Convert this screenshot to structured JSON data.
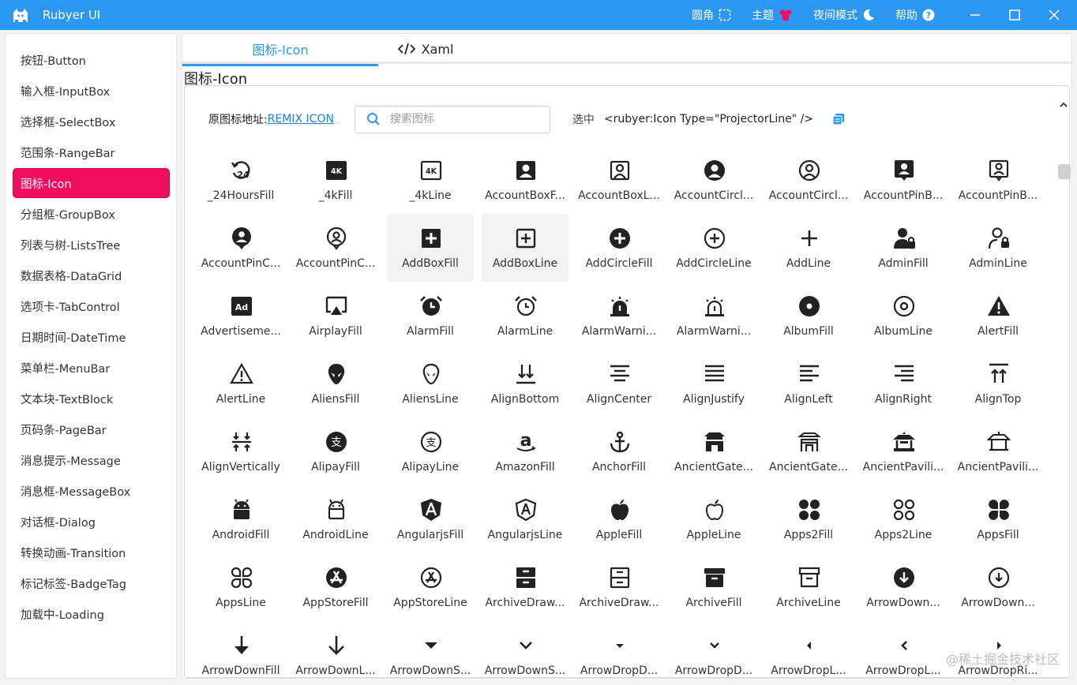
{
  "window": {
    "title": "Rubyer UI",
    "actions": [
      {
        "label": "圆角",
        "icon": "corner-icon"
      },
      {
        "label": "主题",
        "icon": "shirt-icon"
      },
      {
        "label": "夜间模式",
        "icon": "moon-icon"
      },
      {
        "label": "帮助",
        "icon": "help-icon"
      }
    ]
  },
  "sidebar": {
    "items": [
      {
        "label": "按钮-Button"
      },
      {
        "label": "输入框-InputBox"
      },
      {
        "label": "选择框-SelectBox"
      },
      {
        "label": "范围条-RangeBar"
      },
      {
        "label": "图标-Icon",
        "active": true
      },
      {
        "label": "分组框-GroupBox"
      },
      {
        "label": "列表与树-ListsTree"
      },
      {
        "label": "数据表格-DataGrid"
      },
      {
        "label": "选项卡-TabControl"
      },
      {
        "label": "日期时间-DateTime"
      },
      {
        "label": "菜单栏-MenuBar"
      },
      {
        "label": "文本块-TextBlock"
      },
      {
        "label": "页码条-PageBar"
      },
      {
        "label": "消息提示-Message"
      },
      {
        "label": "消息框-MessageBox"
      },
      {
        "label": "对话框-Dialog"
      },
      {
        "label": "转换动画-Transition"
      },
      {
        "label": "标记标签-BadgeTag"
      },
      {
        "label": "加载中-Loading"
      }
    ]
  },
  "tabs": {
    "icon": "图标-Icon",
    "xaml": "Xaml"
  },
  "section_title": "图标-Icon",
  "toolbar": {
    "source_label": "原图标地址:",
    "source_link": "REMIX ICON",
    "search_placeholder": "搜索图标",
    "selected_label": "选中",
    "selected_code": "<rubyer:Icon Type=\"ProjectorLine\" />"
  },
  "icons": [
    [
      "_24HoursFill",
      "_4kFill",
      "_4kLine",
      "AccountBoxF...",
      "AccountBoxL...",
      "AccountCircl...",
      "AccountCircl...",
      "AccountPinB...",
      "AccountPinB..."
    ],
    [
      "AccountPinC...",
      "AccountPinC...",
      "AddBoxFill",
      "AddBoxLine",
      "AddCircleFill",
      "AddCircleLine",
      "AddLine",
      "AdminFill",
      "AdminLine"
    ],
    [
      "Advertiseme...",
      "AirplayFill",
      "AlarmFill",
      "AlarmLine",
      "AlarmWarni...",
      "AlarmWarni...",
      "AlbumFill",
      "AlbumLine",
      "AlertFill"
    ],
    [
      "AlertLine",
      "AliensFill",
      "AliensLine",
      "AlignBottom",
      "AlignCenter",
      "AlignJustify",
      "AlignLeft",
      "AlignRight",
      "AlignTop"
    ],
    [
      "AlignVertically",
      "AlipayFill",
      "AlipayLine",
      "AmazonFill",
      "AnchorFill",
      "AncientGate...",
      "AncientGate...",
      "AncientPavili...",
      "AncientPavili..."
    ],
    [
      "AndroidFill",
      "AndroidLine",
      "AngularjsFill",
      "AngularjsLine",
      "AppleFill",
      "AppleLine",
      "Apps2Fill",
      "Apps2Line",
      "AppsFill"
    ],
    [
      "AppsLine",
      "AppStoreFill",
      "AppStoreLine",
      "ArchiveDraw...",
      "ArchiveDraw...",
      "ArchiveFill",
      "ArchiveLine",
      "ArrowDown...",
      "ArrowDown..."
    ],
    [
      "ArrowDownFill",
      "ArrowDownL...",
      "ArrowDownS...",
      "ArrowDownS...",
      "ArrowDropD...",
      "ArrowDropD...",
      "ArrowDropL...",
      "ArrowDropL...",
      "ArrowDropRi..."
    ]
  ],
  "hovered_icons": [
    "AddBoxFill",
    "AddBoxLine"
  ],
  "watermark": "@稀土掘金技术社区",
  "colors": {
    "titlebar": "#2b97f1",
    "accent": "#2b97f1",
    "active_item": "#f00f5e",
    "link": "#1b7fd6"
  }
}
